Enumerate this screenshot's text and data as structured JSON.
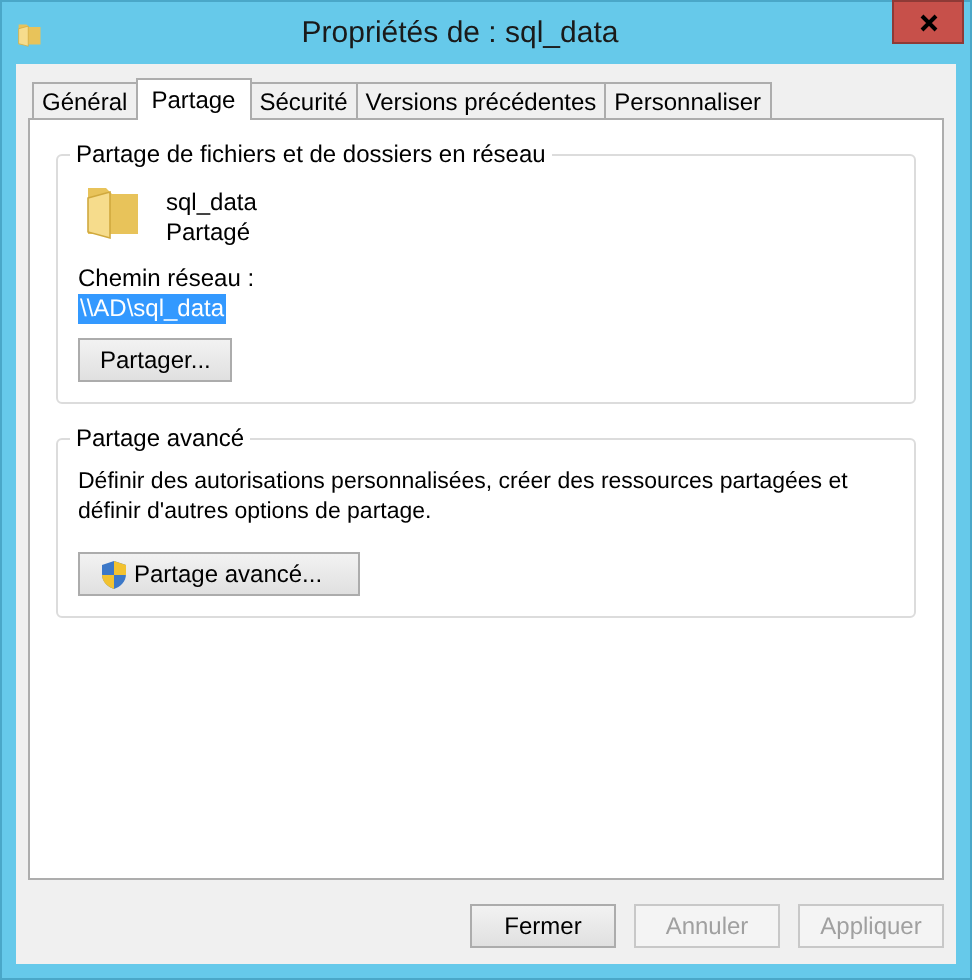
{
  "window": {
    "title": "Propriétés de : sql_data"
  },
  "tabs": [
    {
      "label": "Général",
      "selected": false
    },
    {
      "label": "Partage",
      "selected": true
    },
    {
      "label": "Sécurité",
      "selected": false
    },
    {
      "label": "Versions précédentes",
      "selected": false
    },
    {
      "label": "Personnaliser",
      "selected": false
    }
  ],
  "network_sharing": {
    "title": "Partage de fichiers et de dossiers en réseau",
    "folder_name": "sql_data",
    "status": "Partagé",
    "path_label": "Chemin réseau :",
    "path": "\\\\AD\\sql_data",
    "path_selected": true,
    "button": "Partager..."
  },
  "advanced_sharing": {
    "title": "Partage avancé",
    "description": "Définir des autorisations personnalisées, créer des ressources partagées et définir d'autres options de partage.",
    "button": "Partage avancé..."
  },
  "buttons": [
    {
      "label": "Fermer",
      "disabled": false
    },
    {
      "label": "Annuler",
      "disabled": true
    },
    {
      "label": "Appliquer",
      "disabled": true
    }
  ]
}
